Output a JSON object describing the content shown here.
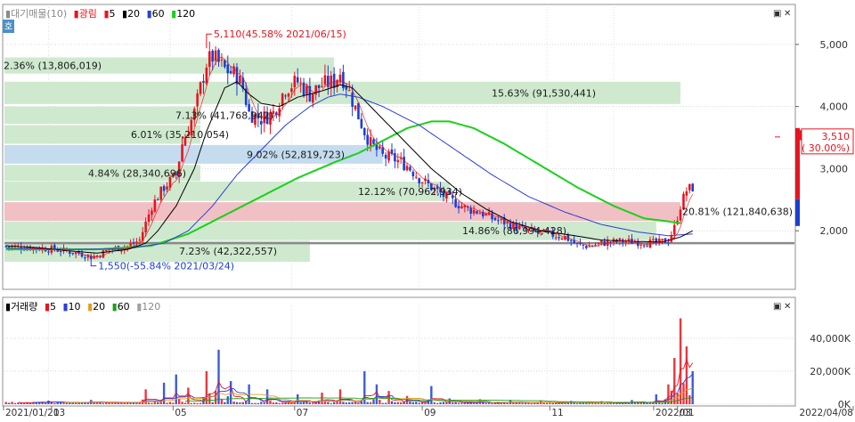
{
  "colors": {
    "up": "#e8141e",
    "down": "#1a3ed6",
    "ma5": "#e8141e",
    "ma20": "#000000",
    "ma60": "#2b3fd6",
    "ma120": "#19d119",
    "vol_ma5": "#e8141e",
    "vol_ma10": "#2b3fd6",
    "vol_ma20": "#e0a020",
    "vol_ma60": "#19a019",
    "vol_ma120": "#a0a0a0",
    "band_green": "#cfe9cf",
    "band_red": "#f0c0c4",
    "band_blue": "#c4dcee",
    "price_box": "#e8141e"
  },
  "toolbar": {
    "side_button": "호",
    "window_buttons": [
      "▣",
      "✕"
    ]
  },
  "price_legend": {
    "items": [
      {
        "marker": "▮",
        "text": "대기매물(10)",
        "color": "#8a8a8a"
      },
      {
        "marker": "▮",
        "text": "광림",
        "color": "#e8141e"
      },
      {
        "marker": "▮",
        "text": "5",
        "color": "#e8141e"
      },
      {
        "marker": "▮",
        "text": "20",
        "color": "#000000"
      },
      {
        "marker": "▮",
        "text": "60",
        "color": "#2b3fd6"
      },
      {
        "marker": "▮",
        "text": "120",
        "color": "#19d119"
      }
    ]
  },
  "volume_legend": {
    "items": [
      {
        "marker": "▮",
        "text": "거래량",
        "color": "#000000"
      },
      {
        "marker": "▮",
        "text": "5",
        "color": "#e8141e"
      },
      {
        "marker": "▮",
        "text": "10",
        "color": "#2b3fd6"
      },
      {
        "marker": "▮",
        "text": "20",
        "color": "#e0a020"
      },
      {
        "marker": "▮",
        "text": "60",
        "color": "#19a019"
      },
      {
        "marker": "▮",
        "text": "120",
        "color": "#a0a0a0"
      }
    ]
  },
  "annotations": {
    "high": "5,110(45.58% 2021/06/15)",
    "low": "1,550(-55.84% 2021/03/24)",
    "current_price": "3,510",
    "current_change": "( 30.00%)"
  },
  "chart_data": [
    {
      "type": "candlestick",
      "title": "",
      "ylim": [
        1100,
        5600
      ],
      "yticks": [
        2000,
        3000,
        4000,
        5000
      ],
      "ytick_labels": [
        "2,000",
        "3,000",
        "4,000",
        "5,000"
      ],
      "xtick_labels": [
        "2021/01/21",
        "03",
        "05",
        "07",
        "09",
        "11",
        "2022/01",
        "03",
        "2022/04/08"
      ],
      "support_line": 1800,
      "high": {
        "value": 5110,
        "date": "2021/06/15"
      },
      "low": {
        "value": 1550,
        "date": "2021/03/24"
      },
      "last_close": 3510,
      "supply_bands": [
        {
          "low": 4530,
          "high": 4790,
          "label": "2.36% (13,806,019)",
          "color": "green"
        },
        {
          "low": 4040,
          "high": 4400,
          "label": "15.63% (91,530,441)",
          "color": "green"
        },
        {
          "low": 3720,
          "high": 4000,
          "label": "7.13% (41,768,942)",
          "color": "green"
        },
        {
          "low": 3400,
          "high": 3700,
          "label": "6.01% (35,210,054)",
          "color": "green"
        },
        {
          "low": 3080,
          "high": 3380,
          "label": "9.02% (52,819,723)",
          "color": "blue"
        },
        {
          "low": 2800,
          "high": 3060,
          "label": "4.84% (28,340,696)",
          "color": "green"
        },
        {
          "low": 2480,
          "high": 2790,
          "label": "12.12% (70,962,934)",
          "color": "green"
        },
        {
          "low": 2160,
          "high": 2460,
          "label": "20.81% (121,840,638)",
          "color": "red"
        },
        {
          "low": 1850,
          "high": 2150,
          "label": "14.86% (86,994,428)",
          "color": "green"
        },
        {
          "low": 1500,
          "high": 1840,
          "label": "7.23% (42,322,557)",
          "color": "green"
        }
      ],
      "price_keypoints": [
        [
          0,
          1750
        ],
        [
          8,
          1730
        ],
        [
          16,
          1700
        ],
        [
          24,
          1640
        ],
        [
          28,
          1580
        ],
        [
          30,
          1600
        ],
        [
          34,
          1700
        ],
        [
          40,
          1750
        ],
        [
          44,
          1850
        ],
        [
          48,
          2400
        ],
        [
          52,
          2700
        ],
        [
          56,
          2900
        ],
        [
          58,
          3400
        ],
        [
          62,
          3900
        ],
        [
          64,
          4300
        ],
        [
          66,
          4700
        ],
        [
          68,
          4800
        ],
        [
          72,
          4600
        ],
        [
          76,
          4500
        ],
        [
          78,
          4300
        ],
        [
          80,
          3900
        ],
        [
          84,
          3800
        ],
        [
          88,
          3900
        ],
        [
          92,
          4300
        ],
        [
          96,
          4400
        ],
        [
          100,
          4200
        ],
        [
          104,
          4350
        ],
        [
          108,
          4400
        ],
        [
          110,
          4550
        ],
        [
          112,
          4350
        ],
        [
          114,
          4100
        ],
        [
          118,
          3600
        ],
        [
          120,
          3400
        ],
        [
          124,
          3200
        ],
        [
          128,
          3150
        ],
        [
          132,
          3050
        ],
        [
          136,
          2850
        ],
        [
          140,
          2700
        ],
        [
          146,
          2500
        ],
        [
          152,
          2350
        ],
        [
          156,
          2300
        ],
        [
          160,
          2200
        ],
        [
          166,
          2100
        ],
        [
          172,
          2000
        ],
        [
          178,
          1950
        ],
        [
          184,
          1900
        ],
        [
          188,
          1770
        ],
        [
          192,
          1750
        ],
        [
          196,
          1800
        ],
        [
          202,
          1830
        ],
        [
          208,
          1820
        ],
        [
          214,
          1800
        ],
        [
          218,
          1850
        ],
        [
          220,
          2050
        ],
        [
          222,
          2400
        ],
        [
          224,
          2650
        ],
        [
          226,
          2700
        ]
      ],
      "ma20_keypoints": [
        [
          0,
          1760
        ],
        [
          10,
          1730
        ],
        [
          20,
          1680
        ],
        [
          30,
          1640
        ],
        [
          40,
          1700
        ],
        [
          46,
          1800
        ],
        [
          50,
          2000
        ],
        [
          56,
          2400
        ],
        [
          62,
          3000
        ],
        [
          66,
          3600
        ],
        [
          72,
          4300
        ],
        [
          76,
          4400
        ],
        [
          80,
          4200
        ],
        [
          84,
          4050
        ],
        [
          90,
          4000
        ],
        [
          96,
          4150
        ],
        [
          104,
          4250
        ],
        [
          110,
          4350
        ],
        [
          114,
          4300
        ],
        [
          118,
          4100
        ],
        [
          124,
          3800
        ],
        [
          132,
          3400
        ],
        [
          140,
          3000
        ],
        [
          150,
          2600
        ],
        [
          158,
          2350
        ],
        [
          166,
          2150
        ],
        [
          176,
          2000
        ],
        [
          186,
          1930
        ],
        [
          196,
          1850
        ],
        [
          206,
          1830
        ],
        [
          216,
          1820
        ],
        [
          222,
          1900
        ],
        [
          226,
          2000
        ]
      ],
      "ma60_keypoints": [
        [
          0,
          1720
        ],
        [
          20,
          1700
        ],
        [
          40,
          1710
        ],
        [
          52,
          1800
        ],
        [
          60,
          2000
        ],
        [
          68,
          2400
        ],
        [
          76,
          2900
        ],
        [
          84,
          3300
        ],
        [
          92,
          3700
        ],
        [
          100,
          4000
        ],
        [
          106,
          4150
        ],
        [
          110,
          4200
        ],
        [
          116,
          4150
        ],
        [
          124,
          4000
        ],
        [
          136,
          3700
        ],
        [
          148,
          3300
        ],
        [
          160,
          2900
        ],
        [
          172,
          2550
        ],
        [
          184,
          2300
        ],
        [
          196,
          2100
        ],
        [
          208,
          1980
        ],
        [
          218,
          1920
        ],
        [
          226,
          1950
        ]
      ],
      "ma120_keypoints": [
        [
          0,
          1700
        ],
        [
          30,
          1700
        ],
        [
          48,
          1760
        ],
        [
          60,
          1950
        ],
        [
          72,
          2250
        ],
        [
          84,
          2550
        ],
        [
          96,
          2850
        ],
        [
          108,
          3100
        ],
        [
          116,
          3250
        ],
        [
          124,
          3450
        ],
        [
          132,
          3650
        ],
        [
          140,
          3760
        ],
        [
          146,
          3760
        ],
        [
          154,
          3650
        ],
        [
          164,
          3400
        ],
        [
          176,
          3050
        ],
        [
          188,
          2700
        ],
        [
          200,
          2400
        ],
        [
          210,
          2200
        ],
        [
          218,
          2150
        ],
        [
          222,
          2120
        ]
      ]
    },
    {
      "type": "bar",
      "title": "거래량",
      "ylim": [
        0,
        55000
      ],
      "yticks": [
        0,
        20000,
        40000
      ],
      "ytick_labels": [
        "0K",
        "20,000K",
        "40,000K"
      ],
      "volume_spikes": [
        [
          14,
          2200
        ],
        [
          28,
          2600
        ],
        [
          46,
          9000
        ],
        [
          52,
          13000
        ],
        [
          56,
          18000
        ],
        [
          60,
          10000
        ],
        [
          66,
          20000
        ],
        [
          70,
          33000
        ],
        [
          74,
          14000
        ],
        [
          80,
          12000
        ],
        [
          86,
          9000
        ],
        [
          96,
          6000
        ],
        [
          104,
          7000
        ],
        [
          110,
          9000
        ],
        [
          118,
          20000
        ],
        [
          122,
          12000
        ],
        [
          126,
          8000
        ],
        [
          132,
          5000
        ],
        [
          140,
          11000
        ],
        [
          146,
          3500
        ],
        [
          156,
          3000
        ],
        [
          166,
          2600
        ],
        [
          176,
          2200
        ],
        [
          186,
          2000
        ],
        [
          196,
          1800
        ],
        [
          206,
          2500
        ],
        [
          214,
          6000
        ],
        [
          218,
          12000
        ],
        [
          220,
          28000
        ],
        [
          222,
          52000
        ],
        [
          224,
          35000
        ],
        [
          226,
          20000
        ]
      ]
    }
  ]
}
